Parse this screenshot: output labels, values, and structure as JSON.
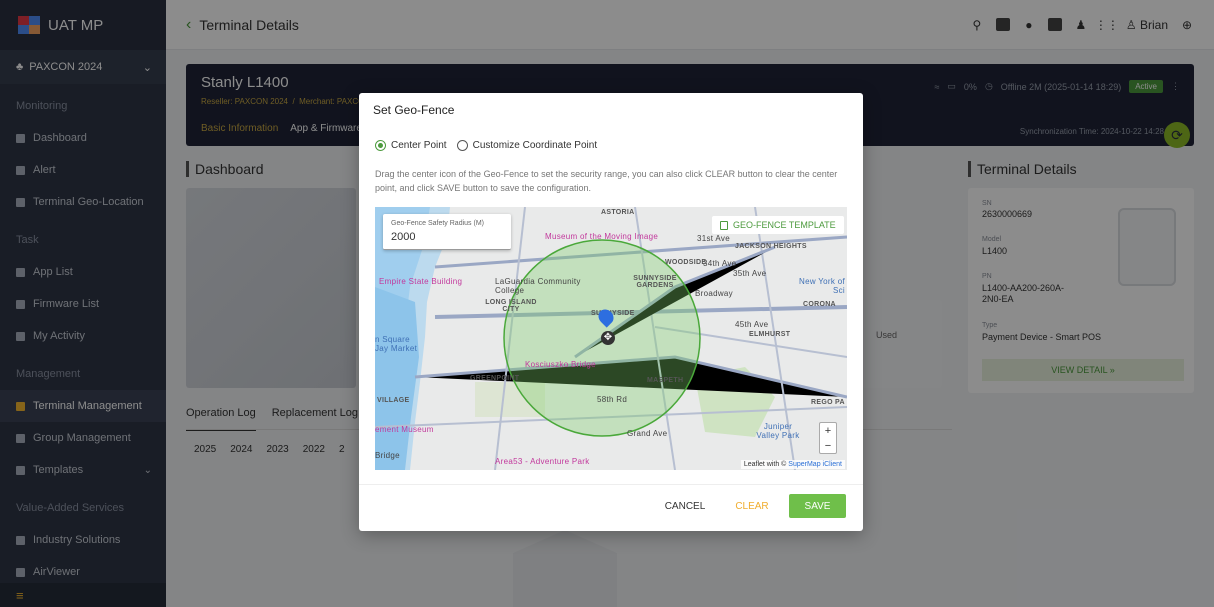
{
  "app": {
    "name": "UAT MP"
  },
  "sidebar": {
    "org": "PAXCON 2024",
    "sections": [
      {
        "title": "Monitoring",
        "items": [
          "Dashboard",
          "Alert",
          "Terminal Geo-Location"
        ]
      },
      {
        "title": "Task",
        "items": [
          "App List",
          "Firmware List",
          "My Activity"
        ]
      },
      {
        "title": "Management",
        "items": [
          "Terminal Management",
          "Group Management",
          "Templates"
        ]
      },
      {
        "title": "Value-Added Services",
        "items": [
          "Industry Solutions",
          "AirViewer"
        ]
      }
    ],
    "active": "Terminal Management"
  },
  "topbar": {
    "title": "Terminal Details",
    "user": "Brian"
  },
  "terminal": {
    "name": "Stanly L1400",
    "reseller": "Reseller: PAXCON 2024",
    "merchant": "Merchant: PAXCO",
    "tabs": [
      "Basic Information",
      "App & Firmware"
    ],
    "battery": "0%",
    "status_text": "Offline 2M (2025-01-14 18:29)",
    "active_label": "Active",
    "sync_time": "Synchronization Time: 2024-10-22 14:28"
  },
  "dashboard": {
    "label": "Dashboard",
    "used_label": "Used"
  },
  "details": {
    "label": "Terminal Details",
    "sn_label": "SN",
    "sn": "2630000669",
    "model_label": "Model",
    "model": "L1400",
    "pn_label": "PN",
    "pn": "L1400-AA200-260A-2N0-EA",
    "type_label": "Type",
    "type": "Payment Device - Smart POS",
    "view_detail": "VIEW DETAIL »"
  },
  "logs": {
    "tabs": [
      "Operation Log",
      "Replacement Log"
    ],
    "years": [
      "2025",
      "2024",
      "2023",
      "2022",
      "2"
    ]
  },
  "modal": {
    "title": "Set Geo-Fence",
    "option_center": "Center Point",
    "option_custom": "Customize Coordinate Point",
    "description": "Drag the center icon of the Geo-Fence to set the security range, you can also click CLEAR button to clear the center point, and click SAVE button to save the configuration.",
    "radius_label": "Geo-Fence Safety Radius (M)",
    "radius_value": "2000",
    "template_button": "GEO-FENCE TEMPLATE",
    "attribution_prefix": "Leaflet with ©",
    "attribution_link": "SuperMap iClient",
    "cancel": "CANCEL",
    "clear": "CLEAR",
    "save": "SAVE",
    "map_labels": {
      "museum": "Museum of the Moving Image",
      "astoria": "ASTORIA",
      "empire": "Empire State Building",
      "woodside": "WOODSIDE",
      "jackson": "JACKSON HEIGHTS",
      "st31": "31st Ave",
      "st34": "34th Ave",
      "st35": "35th Ave",
      "laguardia": "LaGuardia Community College",
      "sunnyside_gardens": "SUNNYSIDE GARDENS",
      "newyork": "New York of Sci",
      "long_island": "LONG ISLAND CITY",
      "sunnyside": "SUNNYSIDE",
      "corona": "CORONA",
      "ave45": "45th Ave",
      "elmhurst": "ELMHURST",
      "square": "n Square Jay Market",
      "kosciuszko": "Kosciuszko Bridge",
      "greenpoint": "GREENPOINT",
      "maspeth": "MASPETH",
      "village": "VILLAGE",
      "rego": "REGO PA",
      "rd58": "58th Rd",
      "grand_ave": "Grand Ave",
      "museum2": "ement Museum",
      "juniper": "Juniper Valley Park",
      "bridge": "Bridge",
      "area53": "Area53 - Adventure Park",
      "broadway": "Broadway"
    }
  }
}
